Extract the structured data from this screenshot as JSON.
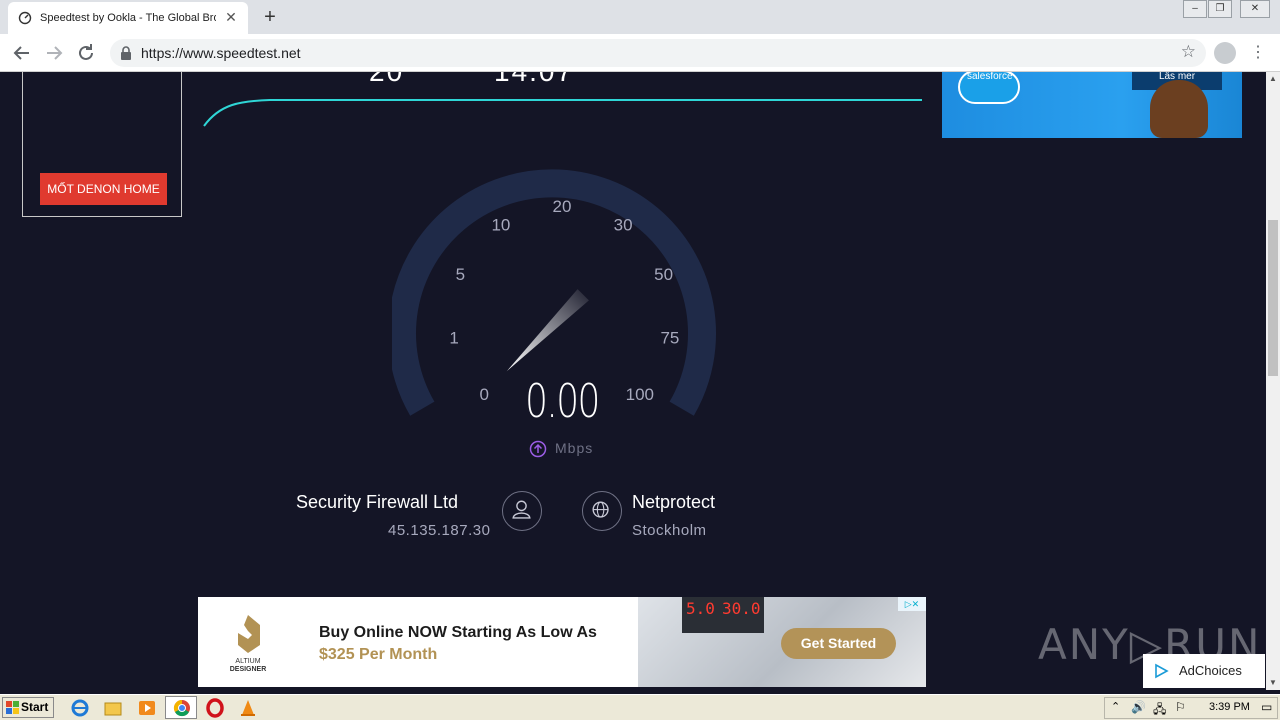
{
  "browser": {
    "tab_title": "Speedtest by Ookla - The Global Bro",
    "tab_close": "✕",
    "new_tab": "+",
    "url": "https://www.speedtest.net",
    "window_controls": [
      "–",
      "❐",
      "✕"
    ]
  },
  "page": {
    "left_ad": {
      "button_label": "MỐT DENON HOME"
    },
    "top_values": {
      "ping": "20",
      "download": "14.07"
    },
    "right_ad": {
      "brand": "salesforce",
      "cta": "Läs mer"
    },
    "gauge": {
      "ticks": [
        "0",
        "1",
        "5",
        "10",
        "20",
        "30",
        "50",
        "75",
        "100"
      ],
      "reading": "0.00",
      "unit": "Mbps",
      "value": 0
    },
    "isp": {
      "name": "Security Firewall Ltd",
      "ip": "45.135.187.30"
    },
    "server": {
      "name": "Netprotect",
      "location": "Stockholm"
    }
  },
  "bottom_ad": {
    "brand_line1": "ALTIUM",
    "brand_line2": "DESIGNER",
    "headline": "Buy Online NOW Starting As Low As",
    "price_line": "$325 Per Month",
    "cta": "Get Started",
    "screen_values": [
      "5.0",
      "30.0"
    ]
  },
  "watermark": "ANY▷RUN",
  "adchoices_label": "AdChoices",
  "taskbar": {
    "start_label": "Start",
    "clock": "3:39 PM"
  },
  "colors": {
    "page_bg": "#141526",
    "gauge_track": "#1f2a48",
    "accent_cyan": "#2fd6d6",
    "upload_purple": "#9b5de5"
  }
}
